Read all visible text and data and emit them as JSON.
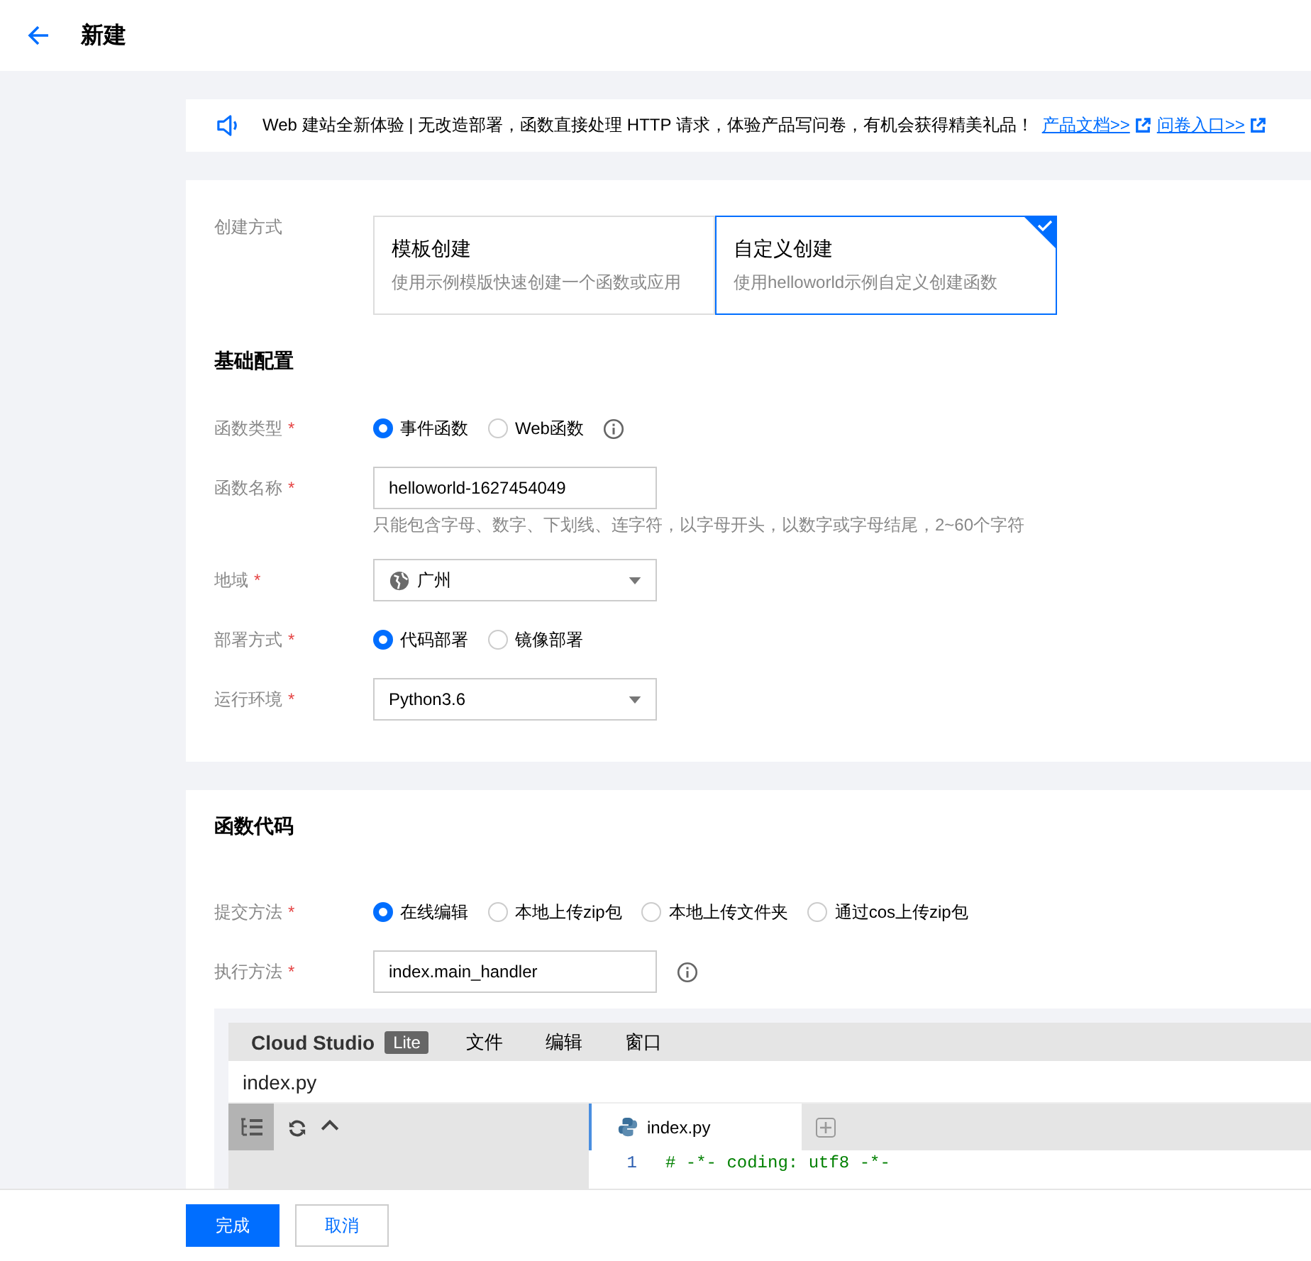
{
  "header": {
    "title": "新建"
  },
  "notice": {
    "text": "Web 建站全新体验 | 无改造部署，函数直接处理 HTTP 请求，体验产品写问卷，有机会获得精美礼品！",
    "links": [
      "产品文档>>",
      "问卷入口>>"
    ]
  },
  "create_mode": {
    "label": "创建方式",
    "options": [
      {
        "title": "模板创建",
        "desc": "使用示例模版快速创建一个函数或应用",
        "selected": false
      },
      {
        "title": "自定义创建",
        "desc": "使用helloworld示例自定义创建函数",
        "selected": true
      }
    ]
  },
  "basic": {
    "title": "基础配置",
    "fields": [
      {
        "kind": "radio",
        "label": "函数类型",
        "required": "*",
        "info": true,
        "options": [
          {
            "label": "事件函数",
            "selected": true
          },
          {
            "label": "Web函数",
            "selected": false
          }
        ]
      },
      {
        "kind": "input",
        "label": "函数名称",
        "required": "*",
        "value": "helloworld-1627454049",
        "hint": "只能包含字母、数字、下划线、连字符，以字母开头，以数字或字母结尾，2~60个字符"
      },
      {
        "kind": "select",
        "label": "地域",
        "required": "*",
        "value": "广州",
        "globe": true
      },
      {
        "kind": "radio",
        "label": "部署方式",
        "required": "*",
        "options": [
          {
            "label": "代码部署",
            "selected": true
          },
          {
            "label": "镜像部署",
            "selected": false
          }
        ]
      },
      {
        "kind": "select",
        "label": "运行环境",
        "required": "*",
        "value": "Python3.6"
      }
    ]
  },
  "code": {
    "title": "函数代码",
    "fields": [
      {
        "kind": "radio",
        "label": "提交方法",
        "required": "*",
        "options": [
          {
            "label": "在线编辑",
            "selected": true
          },
          {
            "label": "本地上传zip包",
            "selected": false
          },
          {
            "label": "本地上传文件夹",
            "selected": false
          },
          {
            "label": "通过cos上传zip包",
            "selected": false
          }
        ]
      },
      {
        "kind": "input",
        "label": "执行方法",
        "required": "*",
        "value": "index.main_handler",
        "info": true
      }
    ],
    "editor": {
      "logo": "Cloud Studio",
      "badge": "Lite",
      "menu": [
        "文件",
        "编辑",
        "窗口"
      ],
      "path": "index.py",
      "tab": "index.py",
      "lines": [
        {
          "number": "1",
          "text": "# -*- coding: utf8 -*-"
        }
      ]
    }
  },
  "footer": {
    "buttons": [
      {
        "label": "完成",
        "primary": true
      },
      {
        "label": "取消",
        "primary": false
      }
    ]
  }
}
